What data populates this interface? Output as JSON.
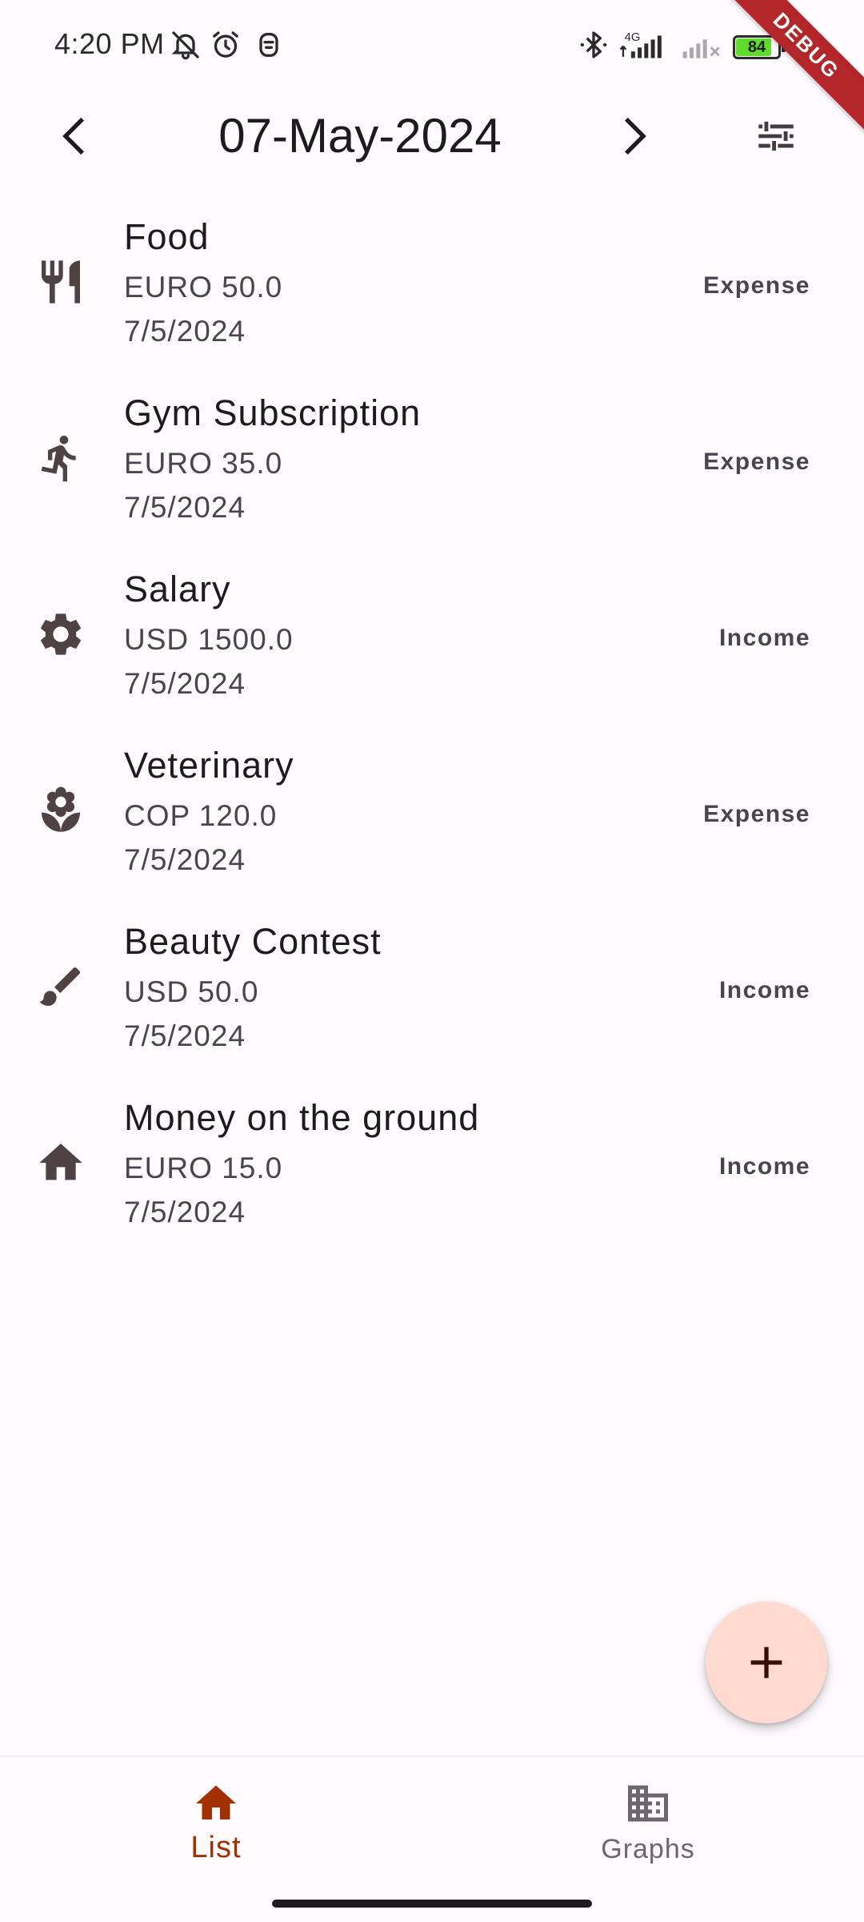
{
  "status_bar": {
    "time": "4:20 PM",
    "icons": [
      "bell-off-icon",
      "alarm-icon",
      "face-icon",
      "bluetooth-icon",
      "signal-4g-icon",
      "signal-off-icon"
    ],
    "network_label": "4G",
    "battery_level": "84",
    "battery_fraction": 0.84,
    "battery_color": "#5fdc2b"
  },
  "debug_banner": "DEBUG",
  "header": {
    "date": "07-May-2024",
    "prev_icon": "chevron-left-icon",
    "next_icon": "chevron-right-icon",
    "filter_icon": "tune-icon"
  },
  "transactions": [
    {
      "icon": "restaurant-icon",
      "title": "Food",
      "amount": "EURO 50.0",
      "date": "7/5/2024",
      "type": "Expense"
    },
    {
      "icon": "directions-run-icon",
      "title": "Gym Subscription",
      "amount": "EURO 35.0",
      "date": "7/5/2024",
      "type": "Expense"
    },
    {
      "icon": "settings-icon",
      "title": "Salary",
      "amount": "USD 1500.0",
      "date": "7/5/2024",
      "type": "Income"
    },
    {
      "icon": "local-florist-icon",
      "title": "Veterinary",
      "amount": "COP 120.0",
      "date": "7/5/2024",
      "type": "Expense"
    },
    {
      "icon": "brush-icon",
      "title": "Beauty Contest",
      "amount": "USD 50.0",
      "date": "7/5/2024",
      "type": "Income"
    },
    {
      "icon": "home-icon",
      "title": "Money on the ground",
      "amount": "EURO 15.0",
      "date": "7/5/2024",
      "type": "Income"
    }
  ],
  "fab": {
    "icon": "add-icon"
  },
  "bottom_nav": {
    "tabs": [
      {
        "label": "List",
        "icon": "home-icon",
        "selected": true
      },
      {
        "label": "Graphs",
        "icon": "business-icon",
        "selected": false
      }
    ]
  },
  "colors": {
    "background": "#fffbfe",
    "accent": "#a33000",
    "fab_background": "#ffdad1",
    "icon": "#4e4342",
    "debug_ribbon": "#b3262a"
  }
}
